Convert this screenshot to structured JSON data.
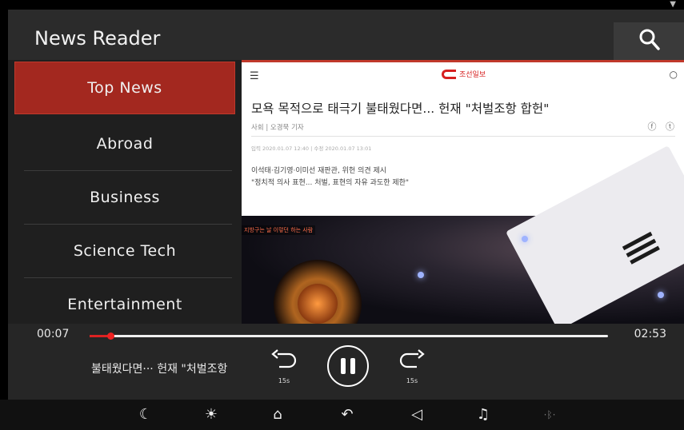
{
  "app": {
    "title": "News Reader"
  },
  "sidebar": {
    "items": [
      {
        "label": "Top News",
        "active": true
      },
      {
        "label": "Abroad"
      },
      {
        "label": "Business"
      },
      {
        "label": "Science Tech"
      },
      {
        "label": "Entertainment"
      }
    ]
  },
  "article": {
    "logo_text": "조선일보",
    "headline": "모욕 목적으로 태극기 불태웠다면... 헌재 \"처벌조항 합헌\"",
    "byline": "사회 | 오경묵 기자",
    "datetime": "입력 2020.01.07 12:40 | 수정 2020.01.07 13:01",
    "summary": [
      "이석태·김기영·이미선 재판관, 위헌 의견 제시",
      "\"정치적 의사 표현... 처벌, 표현의 자유 과도한 제한\""
    ],
    "photo_caption": "지방구는 날 이렇던 하는 사람"
  },
  "player": {
    "current_time": "00:07",
    "total_time": "02:53",
    "progress": 0.04,
    "now_playing": "불태웠다면··· 헌재 \"처벌조항",
    "skip_back_label": "15s",
    "skip_forward_label": "15s"
  },
  "colors": {
    "accent": "#a3281f",
    "progress": "#dd2222",
    "appbar": "#2b2b2b"
  }
}
